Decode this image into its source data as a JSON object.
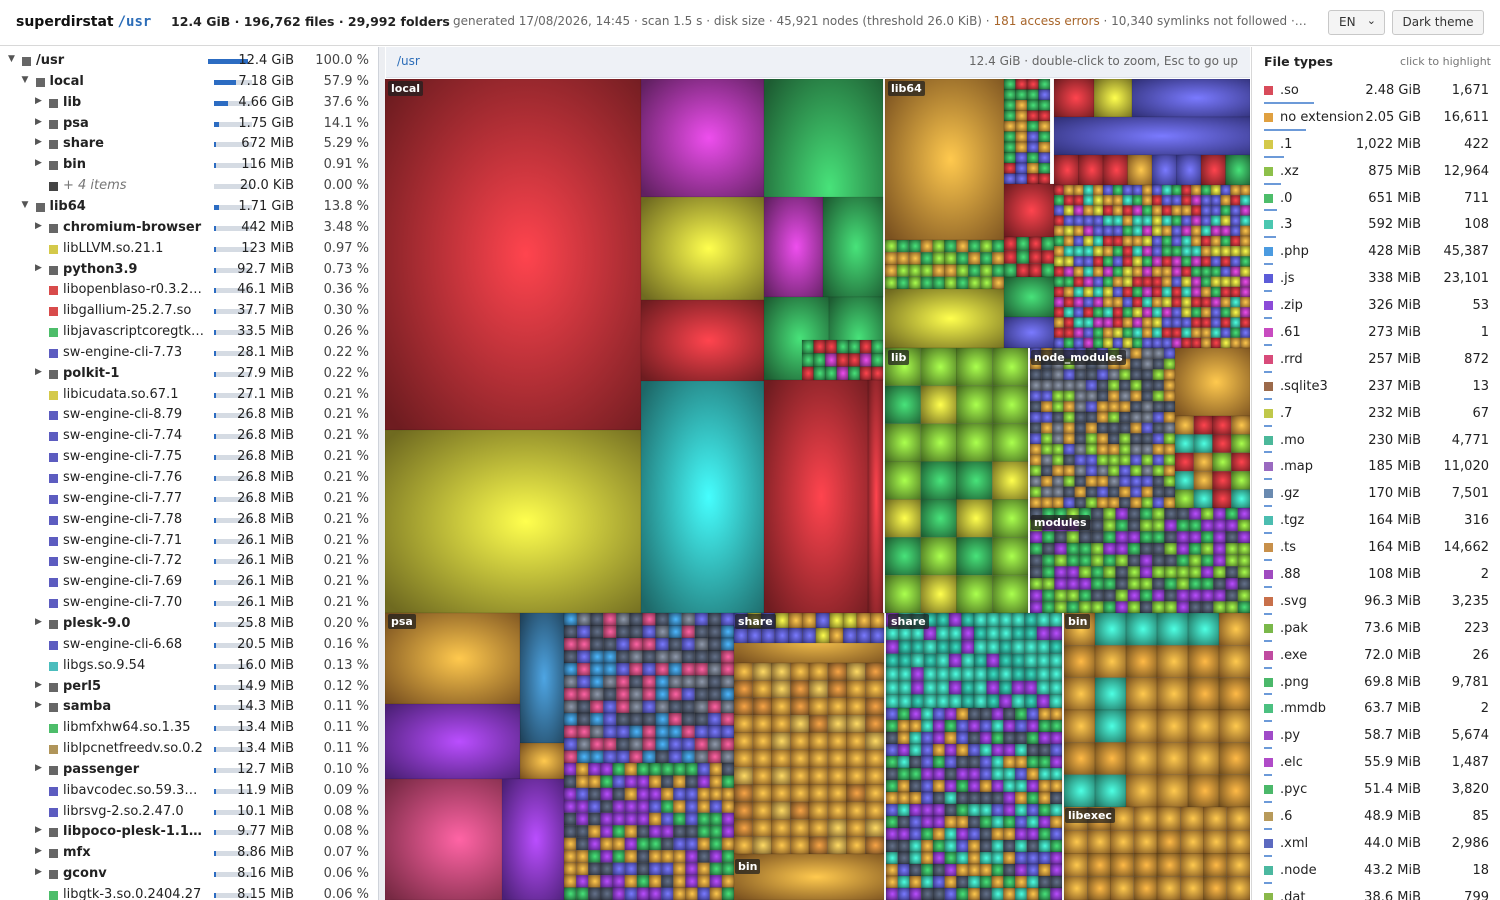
{
  "header": {
    "app_name": "superdirstat",
    "root_path": "/usr",
    "summary": "12.4 GiB · 196,762 files · 29,992 folders",
    "meta_prefix": "generated 17/08/2026, 14:45 · scan 1.5 s · disk size · 45,921 nodes (threshold 26.0 KiB) · ",
    "access_errors": "181 access errors",
    "meta_suffix": " · 10,340 symlinks not followed ·…",
    "language": "EN",
    "theme_button": "Dark theme"
  },
  "tree": [
    {
      "name": "/usr",
      "size": "12.4 GiB",
      "pct": "100.0 %",
      "share": 1.0,
      "depth": 0,
      "toggle": "▼",
      "dir": true,
      "color": "#666666"
    },
    {
      "name": "local",
      "size": "7.18 GiB",
      "pct": "57.9 %",
      "share": 0.579,
      "depth": 1,
      "toggle": "▼",
      "dir": true,
      "color": "#666666"
    },
    {
      "name": "lib",
      "size": "4.66 GiB",
      "pct": "37.6 %",
      "share": 0.376,
      "depth": 2,
      "toggle": "▶",
      "dir": true,
      "color": "#666666"
    },
    {
      "name": "psa",
      "size": "1.75 GiB",
      "pct": "14.1 %",
      "share": 0.141,
      "depth": 2,
      "toggle": "▶",
      "dir": true,
      "color": "#666666"
    },
    {
      "name": "share",
      "size": "672 MiB",
      "pct": "5.29 %",
      "share": 0.0529,
      "depth": 2,
      "toggle": "▶",
      "dir": true,
      "color": "#666666"
    },
    {
      "name": "bin",
      "size": "116 MiB",
      "pct": "0.91 %",
      "share": 0.0091,
      "depth": 2,
      "toggle": "▶",
      "dir": true,
      "color": "#666666"
    },
    {
      "name": "+ 4 items",
      "size": "20.0 KiB",
      "pct": "0.00 %",
      "share": 0,
      "depth": 2,
      "toggle": "",
      "dir": false,
      "more": true,
      "color": "#444444"
    },
    {
      "name": "lib64",
      "size": "1.71 GiB",
      "pct": "13.8 %",
      "share": 0.138,
      "depth": 1,
      "toggle": "▼",
      "dir": true,
      "color": "#666666"
    },
    {
      "name": "chromium-browser",
      "size": "442 MiB",
      "pct": "3.48 %",
      "share": 0.0348,
      "depth": 2,
      "toggle": "▶",
      "dir": true,
      "color": "#666666"
    },
    {
      "name": "libLLVM.so.21.1",
      "size": "123 MiB",
      "pct": "0.97 %",
      "share": 0.0097,
      "depth": 2,
      "toggle": "",
      "dir": false,
      "color": "#d4c94a"
    },
    {
      "name": "python3.9",
      "size": "92.7 MiB",
      "pct": "0.73 %",
      "share": 0.0073,
      "depth": 2,
      "toggle": "▶",
      "dir": true,
      "color": "#666666"
    },
    {
      "name": "libopenblaso-r0.3.2…",
      "size": "46.1 MiB",
      "pct": "0.36 %",
      "share": 0.0036,
      "depth": 2,
      "toggle": "",
      "dir": false,
      "color": "#d84b4b"
    },
    {
      "name": "libgallium-25.2.7.so",
      "size": "37.7 MiB",
      "pct": "0.30 %",
      "share": 0.003,
      "depth": 2,
      "toggle": "",
      "dir": false,
      "color": "#d84b4b"
    },
    {
      "name": "libjavascriptcoregtk…",
      "size": "33.5 MiB",
      "pct": "0.26 %",
      "share": 0.0026,
      "depth": 2,
      "toggle": "",
      "dir": false,
      "color": "#4dbd6a"
    },
    {
      "name": "sw-engine-cli-7.73",
      "size": "28.1 MiB",
      "pct": "0.22 %",
      "share": 0.0022,
      "depth": 2,
      "toggle": "",
      "dir": false,
      "color": "#5c5cc0"
    },
    {
      "name": "polkit-1",
      "size": "27.9 MiB",
      "pct": "0.22 %",
      "share": 0.0022,
      "depth": 2,
      "toggle": "▶",
      "dir": true,
      "color": "#666666"
    },
    {
      "name": "libicudata.so.67.1",
      "size": "27.1 MiB",
      "pct": "0.21 %",
      "share": 0.0021,
      "depth": 2,
      "toggle": "",
      "dir": false,
      "color": "#d4c94a"
    },
    {
      "name": "sw-engine-cli-8.79",
      "size": "26.8 MiB",
      "pct": "0.21 %",
      "share": 0.0021,
      "depth": 2,
      "toggle": "",
      "dir": false,
      "color": "#5c5cc0"
    },
    {
      "name": "sw-engine-cli-7.74",
      "size": "26.8 MiB",
      "pct": "0.21 %",
      "share": 0.0021,
      "depth": 2,
      "toggle": "",
      "dir": false,
      "color": "#5c5cc0"
    },
    {
      "name": "sw-engine-cli-7.75",
      "size": "26.8 MiB",
      "pct": "0.21 %",
      "share": 0.0021,
      "depth": 2,
      "toggle": "",
      "dir": false,
      "color": "#5c5cc0"
    },
    {
      "name": "sw-engine-cli-7.76",
      "size": "26.8 MiB",
      "pct": "0.21 %",
      "share": 0.0021,
      "depth": 2,
      "toggle": "",
      "dir": false,
      "color": "#5c5cc0"
    },
    {
      "name": "sw-engine-cli-7.77",
      "size": "26.8 MiB",
      "pct": "0.21 %",
      "share": 0.0021,
      "depth": 2,
      "toggle": "",
      "dir": false,
      "color": "#5c5cc0"
    },
    {
      "name": "sw-engine-cli-7.78",
      "size": "26.8 MiB",
      "pct": "0.21 %",
      "share": 0.0021,
      "depth": 2,
      "toggle": "",
      "dir": false,
      "color": "#5c5cc0"
    },
    {
      "name": "sw-engine-cli-7.71",
      "size": "26.1 MiB",
      "pct": "0.21 %",
      "share": 0.0021,
      "depth": 2,
      "toggle": "",
      "dir": false,
      "color": "#5c5cc0"
    },
    {
      "name": "sw-engine-cli-7.72",
      "size": "26.1 MiB",
      "pct": "0.21 %",
      "share": 0.0021,
      "depth": 2,
      "toggle": "",
      "dir": false,
      "color": "#5c5cc0"
    },
    {
      "name": "sw-engine-cli-7.69",
      "size": "26.1 MiB",
      "pct": "0.21 %",
      "share": 0.0021,
      "depth": 2,
      "toggle": "",
      "dir": false,
      "color": "#5c5cc0"
    },
    {
      "name": "sw-engine-cli-7.70",
      "size": "26.1 MiB",
      "pct": "0.21 %",
      "share": 0.0021,
      "depth": 2,
      "toggle": "",
      "dir": false,
      "color": "#5c5cc0"
    },
    {
      "name": "plesk-9.0",
      "size": "25.8 MiB",
      "pct": "0.20 %",
      "share": 0.002,
      "depth": 2,
      "toggle": "▶",
      "dir": true,
      "color": "#666666"
    },
    {
      "name": "sw-engine-cli-6.68",
      "size": "20.5 MiB",
      "pct": "0.16 %",
      "share": 0.0016,
      "depth": 2,
      "toggle": "",
      "dir": false,
      "color": "#5c5cc0"
    },
    {
      "name": "libgs.so.9.54",
      "size": "16.0 MiB",
      "pct": "0.13 %",
      "share": 0.0013,
      "depth": 2,
      "toggle": "",
      "dir": false,
      "color": "#4bbdbd"
    },
    {
      "name": "perl5",
      "size": "14.9 MiB",
      "pct": "0.12 %",
      "share": 0.0012,
      "depth": 2,
      "toggle": "▶",
      "dir": true,
      "color": "#666666"
    },
    {
      "name": "samba",
      "size": "14.3 MiB",
      "pct": "0.11 %",
      "share": 0.0011,
      "depth": 2,
      "toggle": "▶",
      "dir": true,
      "color": "#666666"
    },
    {
      "name": "libmfxhw64.so.1.35",
      "size": "13.4 MiB",
      "pct": "0.11 %",
      "share": 0.0011,
      "depth": 2,
      "toggle": "",
      "dir": false,
      "color": "#4dbd6a"
    },
    {
      "name": "liblpcnetfreedv.so.0.2",
      "size": "13.4 MiB",
      "pct": "0.11 %",
      "share": 0.0011,
      "depth": 2,
      "toggle": "",
      "dir": false,
      "color": "#b0955a"
    },
    {
      "name": "passenger",
      "size": "12.7 MiB",
      "pct": "0.10 %",
      "share": 0.001,
      "depth": 2,
      "toggle": "▶",
      "dir": true,
      "color": "#666666"
    },
    {
      "name": "libavcodec.so.59.37…",
      "size": "11.9 MiB",
      "pct": "0.09 %",
      "share": 0.0009,
      "depth": 2,
      "toggle": "",
      "dir": false,
      "color": "#5c5cc0"
    },
    {
      "name": "librsvg-2.so.2.47.0",
      "size": "10.1 MiB",
      "pct": "0.08 %",
      "share": 0.0008,
      "depth": 2,
      "toggle": "",
      "dir": false,
      "color": "#5c5cc0"
    },
    {
      "name": "libpoco-plesk-1.1…",
      "size": "9.77 MiB",
      "pct": "0.08 %",
      "share": 0.0008,
      "depth": 2,
      "toggle": "▶",
      "dir": true,
      "color": "#666666"
    },
    {
      "name": "mfx",
      "size": "8.86 MiB",
      "pct": "0.07 %",
      "share": 0.0007,
      "depth": 2,
      "toggle": "▶",
      "dir": true,
      "color": "#666666"
    },
    {
      "name": "gconv",
      "size": "8.16 MiB",
      "pct": "0.06 %",
      "share": 0.0006,
      "depth": 2,
      "toggle": "▶",
      "dir": true,
      "color": "#666666"
    },
    {
      "name": "libgtk-3.so.0.2404.27",
      "size": "8.15 MiB",
      "pct": "0.06 %",
      "share": 0.0006,
      "depth": 2,
      "toggle": "",
      "dir": false,
      "color": "#4dbd6a"
    }
  ],
  "treemap": {
    "crumb": "/usr",
    "hint": "12.4 GiB · double-click to zoom, Esc to go up",
    "labels": {
      "local": "local",
      "lib64": "lib64",
      "lib": "lib",
      "node_modules": "node_modules",
      "modules": "modules",
      "psa": "psa",
      "share": "share",
      "share2": "share",
      "bin": "bin",
      "bin2": "bin",
      "libexec": "libexec"
    }
  },
  "types": {
    "title": "File types",
    "hint": "click to highlight",
    "items": [
      {
        "ext": ".so",
        "size": "2.48 GiB",
        "count": "1,671",
        "color": "#d84b5a",
        "share": 1.0
      },
      {
        "ext": "no extension",
        "size": "2.05 GiB",
        "count": "16,611",
        "color": "#e0a040",
        "share": 0.83
      },
      {
        "ext": ".1",
        "size": "1,022 MiB",
        "count": "422",
        "color": "#d4c94a",
        "share": 0.4
      },
      {
        "ext": ".xz",
        "size": "875 MiB",
        "count": "12,964",
        "color": "#8dc04a",
        "share": 0.34
      },
      {
        "ext": ".0",
        "size": "651 MiB",
        "count": "711",
        "color": "#4dbd6a",
        "share": 0.26
      },
      {
        "ext": ".3",
        "size": "592 MiB",
        "count": "108",
        "color": "#4bc7b0",
        "share": 0.23
      },
      {
        "ext": ".php",
        "size": "428 MiB",
        "count": "45,387",
        "color": "#4b9be0",
        "share": 0.17
      },
      {
        "ext": ".js",
        "size": "338 MiB",
        "count": "23,101",
        "color": "#5c5cd8",
        "share": 0.13
      },
      {
        "ext": ".zip",
        "size": "326 MiB",
        "count": "53",
        "color": "#8c4bd8",
        "share": 0.13
      },
      {
        "ext": ".61",
        "size": "273 MiB",
        "count": "1",
        "color": "#c84bc0",
        "share": 0.11
      },
      {
        "ext": ".rrd",
        "size": "257 MiB",
        "count": "872",
        "color": "#d84b7a",
        "share": 0.1
      },
      {
        "ext": ".sqlite3",
        "size": "237 MiB",
        "count": "13",
        "color": "#9c6a4a",
        "share": 0.09
      },
      {
        "ext": ".7",
        "size": "232 MiB",
        "count": "67",
        "color": "#c0c84a",
        "share": 0.09
      },
      {
        "ext": ".mo",
        "size": "230 MiB",
        "count": "4,771",
        "color": "#4bb89a",
        "share": 0.09
      },
      {
        "ext": ".map",
        "size": "185 MiB",
        "count": "11,020",
        "color": "#9a6ac0",
        "share": 0.07
      },
      {
        "ext": ".gz",
        "size": "170 MiB",
        "count": "7,501",
        "color": "#6a8ab0",
        "share": 0.07
      },
      {
        "ext": ".tgz",
        "size": "164 MiB",
        "count": "316",
        "color": "#4bbdb0",
        "share": 0.06
      },
      {
        "ext": ".ts",
        "size": "164 MiB",
        "count": "14,662",
        "color": "#c8904a",
        "share": 0.06
      },
      {
        "ext": ".88",
        "size": "108 MiB",
        "count": "2",
        "color": "#a04bc0",
        "share": 0.04
      },
      {
        "ext": ".svg",
        "size": "96.3 MiB",
        "count": "3,235",
        "color": "#c8704a",
        "share": 0.04
      },
      {
        "ext": ".pak",
        "size": "73.6 MiB",
        "count": "223",
        "color": "#7ab84a",
        "share": 0.03
      },
      {
        "ext": ".exe",
        "size": "72.0 MiB",
        "count": "26",
        "color": "#c04ba0",
        "share": 0.03
      },
      {
        "ext": ".png",
        "size": "69.8 MiB",
        "count": "9,781",
        "color": "#4bb86a",
        "share": 0.03
      },
      {
        "ext": ".mmdb",
        "size": "63.7 MiB",
        "count": "2",
        "color": "#4bc080",
        "share": 0.03
      },
      {
        "ext": ".py",
        "size": "58.7 MiB",
        "count": "5,674",
        "color": "#a04bc8",
        "share": 0.02
      },
      {
        "ext": ".elc",
        "size": "55.9 MiB",
        "count": "1,487",
        "color": "#b04bc8",
        "share": 0.02
      },
      {
        "ext": ".pyc",
        "size": "51.4 MiB",
        "count": "3,820",
        "color": "#4bb86a",
        "share": 0.02
      },
      {
        "ext": ".6",
        "size": "48.9 MiB",
        "count": "85",
        "color": "#b89a5a",
        "share": 0.02
      },
      {
        "ext": ".xml",
        "size": "44.0 MiB",
        "count": "2,986",
        "color": "#5c6ac0",
        "share": 0.02
      },
      {
        "ext": ".node",
        "size": "43.2 MiB",
        "count": "18",
        "color": "#4bb8a0",
        "share": 0.02
      },
      {
        "ext": ".dat",
        "size": "38.6 MiB",
        "count": "799",
        "color": "#8ab84a",
        "share": 0.02
      }
    ]
  }
}
